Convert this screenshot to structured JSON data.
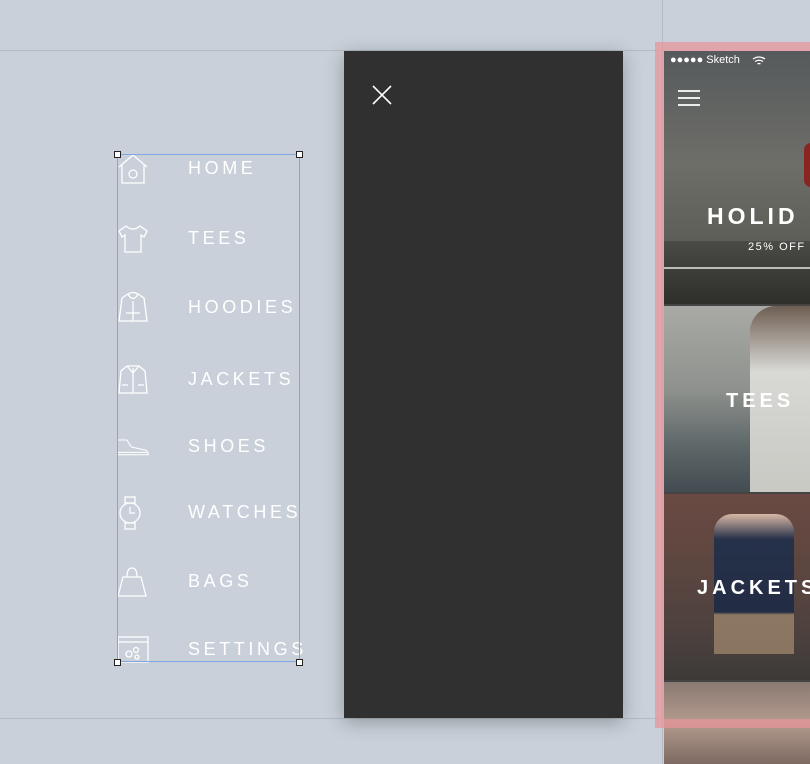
{
  "menu": {
    "items": [
      {
        "label": "HOME",
        "icon": "house-icon"
      },
      {
        "label": "TEES",
        "icon": "tshirt-icon"
      },
      {
        "label": "HOODIES",
        "icon": "hoodie-icon"
      },
      {
        "label": "JACKETS",
        "icon": "jacket-icon"
      },
      {
        "label": "SHOES",
        "icon": "shoe-icon"
      },
      {
        "label": "WATCHES",
        "icon": "watch-icon"
      },
      {
        "label": "BAGS",
        "icon": "bag-icon"
      },
      {
        "label": "SETTINGS",
        "icon": "settings-icon"
      }
    ]
  },
  "drawer": {
    "close_icon": "close-icon"
  },
  "phone": {
    "status": "●●●●● Sketch",
    "panels": [
      {
        "title": "HOLID",
        "subtitle": "25% OFF"
      },
      {
        "title": "TEES"
      },
      {
        "title": "JACKETS"
      },
      {
        "title": ""
      }
    ]
  },
  "colors": {
    "canvas": "#c9d0d9",
    "drawer": "#303030",
    "selection": "#7fa7e0",
    "phone_highlight": "#e79498"
  }
}
